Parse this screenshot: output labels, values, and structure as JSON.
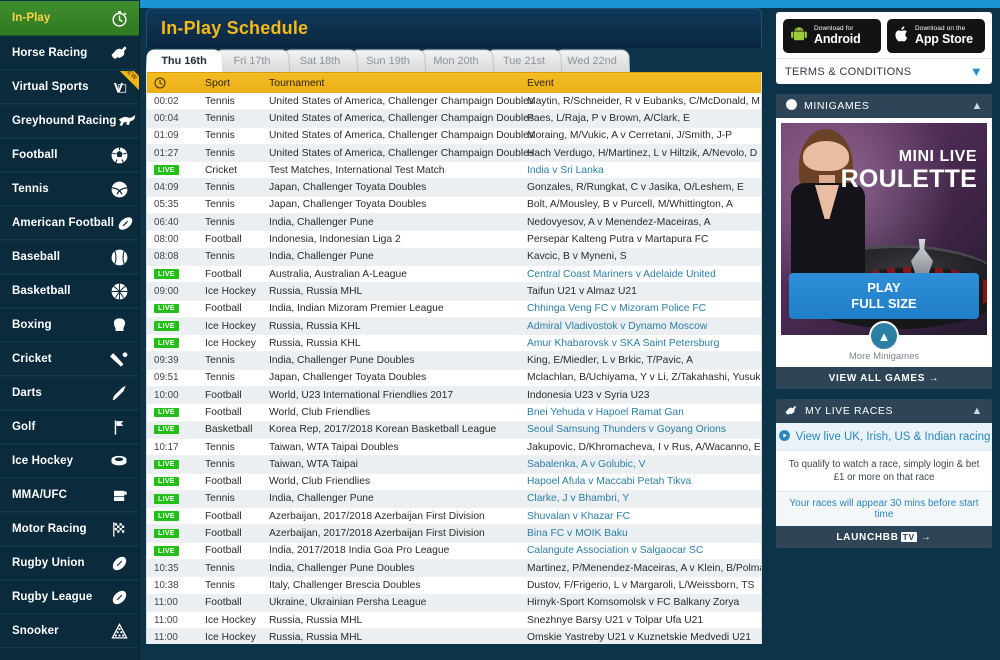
{
  "sidebar": {
    "items": [
      {
        "label": "In-Play",
        "icon": "stopwatch-icon",
        "active": true
      },
      {
        "label": "Horse Racing",
        "icon": "horse-icon"
      },
      {
        "label": "Virtual Sports",
        "icon": "virtual-v-icon",
        "badge": "NEW"
      },
      {
        "label": "Greyhound Racing",
        "icon": "greyhound-icon"
      },
      {
        "label": "Football",
        "icon": "football-icon"
      },
      {
        "label": "Tennis",
        "icon": "tennis-ball-icon"
      },
      {
        "label": "American Football",
        "icon": "american-football-icon"
      },
      {
        "label": "Baseball",
        "icon": "baseball-icon"
      },
      {
        "label": "Basketball",
        "icon": "basketball-icon"
      },
      {
        "label": "Boxing",
        "icon": "boxing-glove-icon"
      },
      {
        "label": "Cricket",
        "icon": "cricket-bat-icon"
      },
      {
        "label": "Darts",
        "icon": "dart-icon"
      },
      {
        "label": "Golf",
        "icon": "golf-flag-icon"
      },
      {
        "label": "Ice Hockey",
        "icon": "hockey-puck-icon"
      },
      {
        "label": "MMA/UFC",
        "icon": "mma-glove-icon"
      },
      {
        "label": "Motor Racing",
        "icon": "checkered-flag-icon"
      },
      {
        "label": "Rugby Union",
        "icon": "rugby-ball-icon"
      },
      {
        "label": "Rugby League",
        "icon": "rugby-ball-icon"
      },
      {
        "label": "Snooker",
        "icon": "snooker-triangle-icon"
      }
    ]
  },
  "main": {
    "title": "In-Play Schedule",
    "tabs": [
      {
        "label": "Thu 16th",
        "active": true
      },
      {
        "label": "Fri 17th",
        "active": false
      },
      {
        "label": "Sat 18th",
        "active": false
      },
      {
        "label": "Sun 19th",
        "active": false
      },
      {
        "label": "Mon 20th",
        "active": false
      },
      {
        "label": "Tue 21st",
        "active": false
      },
      {
        "label": "Wed 22nd",
        "active": false
      }
    ],
    "columns": {
      "time": "",
      "sport": "Sport",
      "tournament": "Tournament",
      "event": "Event"
    },
    "live_label": "LIVE",
    "rows": [
      {
        "time": "00:02",
        "live": false,
        "sport": "Tennis",
        "tournament": "United States of America, Challenger Champaign Doubles",
        "event": "Maytin, R/Schneider, R v Eubanks, C/McDonald, M"
      },
      {
        "time": "00:04",
        "live": false,
        "sport": "Tennis",
        "tournament": "United States of America, Challenger Champaign Doubles",
        "event": "Paes, L/Raja, P v Brown, A/Clark, E"
      },
      {
        "time": "01:09",
        "live": false,
        "sport": "Tennis",
        "tournament": "United States of America, Challenger Champaign Doubles",
        "event": "Moraing, M/Vukic, A v Cerretani, J/Smith, J-P"
      },
      {
        "time": "01:27",
        "live": false,
        "sport": "Tennis",
        "tournament": "United States of America, Challenger Champaign Doubles",
        "event": "Hach Verdugo, H/Martinez, L v Hiltzik, A/Nevolo, D"
      },
      {
        "time": "",
        "live": true,
        "sport": "Cricket",
        "tournament": "Test Matches, International Test Match",
        "event": "India v Sri Lanka"
      },
      {
        "time": "04:09",
        "live": false,
        "sport": "Tennis",
        "tournament": "Japan, Challenger Toyata Doubles",
        "event": "Gonzales, R/Rungkat, C v Jasika, O/Leshem, E"
      },
      {
        "time": "05:35",
        "live": false,
        "sport": "Tennis",
        "tournament": "Japan, Challenger Toyata Doubles",
        "event": "Bolt, A/Mousley, B v Purcell, M/Whittington, A"
      },
      {
        "time": "06:40",
        "live": false,
        "sport": "Tennis",
        "tournament": "India, Challenger Pune",
        "event": "Nedovyesov, A v Menendez-Maceiras, A"
      },
      {
        "time": "08:00",
        "live": false,
        "sport": "Football",
        "tournament": "Indonesia, Indonesian Liga 2",
        "event": "Persepar Kalteng Putra v Martapura FC"
      },
      {
        "time": "08:08",
        "live": false,
        "sport": "Tennis",
        "tournament": "India, Challenger Pune",
        "event": "Kavcic, B v Myneni, S"
      },
      {
        "time": "",
        "live": true,
        "sport": "Football",
        "tournament": "Australia, Australian A-League",
        "event": "Central Coast Mariners v Adelaide United"
      },
      {
        "time": "09:00",
        "live": false,
        "sport": "Ice Hockey",
        "tournament": "Russia, Russia MHL",
        "event": "Taifun U21 v Almaz U21"
      },
      {
        "time": "",
        "live": true,
        "sport": "Football",
        "tournament": "India, Indian Mizoram Premier League",
        "event": "Chhinga Veng FC v Mizoram Police FC"
      },
      {
        "time": "",
        "live": true,
        "sport": "Ice Hockey",
        "tournament": "Russia, Russia KHL",
        "event": "Admiral Vladivostok v Dynamo Moscow"
      },
      {
        "time": "",
        "live": true,
        "sport": "Ice Hockey",
        "tournament": "Russia, Russia KHL",
        "event": "Amur Khabarovsk v SKA Saint Petersburg"
      },
      {
        "time": "09:39",
        "live": false,
        "sport": "Tennis",
        "tournament": "India, Challenger Pune Doubles",
        "event": "King, E/Miedler, L v Brkic, T/Pavic, A"
      },
      {
        "time": "09:51",
        "live": false,
        "sport": "Tennis",
        "tournament": "Japan, Challenger Toyata Doubles",
        "event": "Mclachlan, B/Uchiyama, Y v Li, Z/Takahashi, Yusuke"
      },
      {
        "time": "10:00",
        "live": false,
        "sport": "Football",
        "tournament": "World, U23 International Friendlies 2017",
        "event": "Indonesia U23 v Syria U23"
      },
      {
        "time": "",
        "live": true,
        "sport": "Football",
        "tournament": "World, Club Friendlies",
        "event": "Bnei Yehuda v Hapoel Ramat Gan"
      },
      {
        "time": "",
        "live": true,
        "sport": "Basketball",
        "tournament": "Korea Rep, 2017/2018 Korean Basketball League",
        "event": "Seoul Samsung Thunders v Goyang Orions"
      },
      {
        "time": "10:17",
        "live": false,
        "sport": "Tennis",
        "tournament": "Taiwan, WTA Taipai Doubles",
        "event": "Jakupovic, D/Khromacheva, I v Rus, A/Wacanno, E"
      },
      {
        "time": "",
        "live": true,
        "sport": "Tennis",
        "tournament": "Taiwan, WTA Taipai",
        "event": "Sabalenka, A v Golubic, V"
      },
      {
        "time": "",
        "live": true,
        "sport": "Football",
        "tournament": "World, Club Friendlies",
        "event": "Hapoel Afula v Maccabi Petah Tikva"
      },
      {
        "time": "",
        "live": true,
        "sport": "Tennis",
        "tournament": "India, Challenger Pune",
        "event": "Clarke, J v Bhambri, Y"
      },
      {
        "time": "",
        "live": true,
        "sport": "Football",
        "tournament": "Azerbaijan, 2017/2018 Azerbaijan First Division",
        "event": "Shuvalan v Khazar FC"
      },
      {
        "time": "",
        "live": true,
        "sport": "Football",
        "tournament": "Azerbaijan, 2017/2018 Azerbaijan First Division",
        "event": "Bina FC v MOIK Baku"
      },
      {
        "time": "",
        "live": true,
        "sport": "Football",
        "tournament": "India, 2017/2018 India Goa Pro League",
        "event": "Calangute Association v Salgaocar SC"
      },
      {
        "time": "10:35",
        "live": false,
        "sport": "Tennis",
        "tournament": "India, Challenger Pune Doubles",
        "event": "Martinez, P/Menendez-Maceiras, A v Klein, B/Polmans, M"
      },
      {
        "time": "10:38",
        "live": false,
        "sport": "Tennis",
        "tournament": "Italy, Challenger Brescia Doubles",
        "event": "Dustov, F/Frigerio, L v Margaroli, L/Weissborn, TS"
      },
      {
        "time": "11:00",
        "live": false,
        "sport": "Football",
        "tournament": "Ukraine, Ukrainian Persha League",
        "event": "Hirnyk-Sport Komsomolsk v FC Balkany Zorya"
      },
      {
        "time": "11:00",
        "live": false,
        "sport": "Ice Hockey",
        "tournament": "Russia, Russia MHL",
        "event": "Snezhnye Barsy U21 v Tolpar Ufa U21"
      },
      {
        "time": "11:00",
        "live": false,
        "sport": "Ice Hockey",
        "tournament": "Russia, Russia MHL",
        "event": "Omskie Yastreby U21 v Kuznetskie Medvedi U21"
      }
    ]
  },
  "right": {
    "android": {
      "small": "Download for",
      "big": "Android"
    },
    "appstore": {
      "small": "Download on the",
      "big": "App Store"
    },
    "terms": "TERMS & CONDITIONS",
    "minigames": {
      "title": "MINIGAMES",
      "promo_line1": "MINI LIVE",
      "promo_line2": "ROULETTE",
      "play_line1": "PLAY",
      "play_line2": "FULL SIZE",
      "more": "More Minigames",
      "view_all": "VIEW ALL GAMES →"
    },
    "live_races": {
      "title": "MY LIVE RACES",
      "link": "View live UK, Irish, US & Indian racing",
      "note": "To qualify to watch a race, simply login & bet £1 or more on that race",
      "sub": "Your races will appear 30 mins before start time",
      "launch_prefix": "LAUNCH",
      "launch_bb": "BB",
      "launch_tv": "TV",
      "launch_arrow": "→"
    }
  },
  "colors": {
    "accent_yellow": "#f5b914",
    "header_yellow": "#f0b71e",
    "live_green": "#22c016",
    "link_blue": "#2a7fa8",
    "panel_dark": "#2e4457",
    "top_blue": "#1b94d4",
    "inplay_green": "#3f8f2e"
  }
}
